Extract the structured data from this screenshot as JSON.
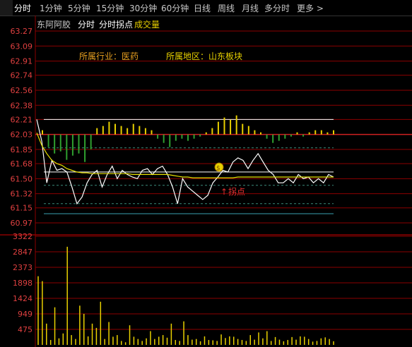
{
  "tabs": [
    {
      "label": "分时",
      "active": true
    },
    {
      "label": "1分钟"
    },
    {
      "label": "5分钟"
    },
    {
      "label": "15分钟"
    },
    {
      "label": "30分钟"
    },
    {
      "label": "60分钟"
    },
    {
      "label": "日线"
    },
    {
      "label": "周线"
    },
    {
      "label": "月线"
    },
    {
      "label": "多分时"
    },
    {
      "label": "更多 >"
    }
  ],
  "subbar": {
    "stock_name": "东阿阿胶",
    "mode": "分时",
    "indicator": "分时拐点",
    "volume_label": "成交量"
  },
  "annotations": {
    "industry": "所属行业：医药",
    "region": "所属地区：山东板块",
    "turning_point": "拐点",
    "money_icon": "money-bag-icon"
  },
  "colors": {
    "price_line": "#ffffff",
    "avg_line": "#e8e000",
    "up": "#e03030",
    "down": "#2fa02f",
    "grid": "#8b0000",
    "axis_label": "#e04040"
  },
  "chart_data": [
    {
      "type": "line",
      "title": "分时",
      "y_ticks": [
        "63.27",
        "63.09",
        "62.91",
        "62.74",
        "62.56",
        "62.38",
        "62.21",
        "62.03",
        "61.85",
        "61.68",
        "61.50",
        "61.32",
        "61.15",
        "60.97"
      ],
      "ylim": [
        60.97,
        63.27
      ],
      "prev_close": 62.03,
      "series": [
        {
          "name": "price",
          "values": [
            62.21,
            61.95,
            61.45,
            61.72,
            61.6,
            61.62,
            61.58,
            61.4,
            61.2,
            61.28,
            61.45,
            61.55,
            61.6,
            61.4,
            61.55,
            61.65,
            61.5,
            61.6,
            61.55,
            61.52,
            61.5,
            61.6,
            61.62,
            61.55,
            61.62,
            61.65,
            61.55,
            61.4,
            61.2,
            61.5,
            61.4,
            61.35,
            61.3,
            61.25,
            61.3,
            61.45,
            61.52,
            61.6,
            61.58,
            61.7,
            61.75,
            61.72,
            61.62,
            61.72,
            61.8,
            61.7,
            61.6,
            61.55,
            61.45,
            61.45,
            61.5,
            61.45,
            61.55,
            61.5,
            61.52,
            61.45,
            61.5,
            61.45,
            61.55,
            61.52
          ]
        },
        {
          "name": "avg",
          "values": [
            62.05,
            61.9,
            61.8,
            61.72,
            61.68,
            61.66,
            61.62,
            61.6,
            61.58,
            61.57,
            61.57,
            61.56,
            61.56,
            61.56,
            61.56,
            61.56,
            61.56,
            61.56,
            61.56,
            61.55,
            61.55,
            61.55,
            61.55,
            61.55,
            61.55,
            61.55,
            61.55,
            61.54,
            61.53,
            61.52,
            61.52,
            61.51,
            61.51,
            61.51,
            61.51,
            61.51,
            61.51,
            61.51,
            61.51,
            61.51,
            61.52,
            61.52,
            61.52,
            61.52,
            61.52,
            61.52,
            61.52,
            61.52,
            61.52,
            61.52,
            61.52,
            61.52,
            61.52,
            61.52,
            61.52,
            61.52,
            61.52,
            61.52,
            61.52,
            61.52
          ]
        }
      ],
      "bars": [
        0.2,
        -0.6,
        -0.9,
        -0.8,
        -1.2,
        -1.0,
        -0.9,
        -1.3,
        -0.7,
        0.3,
        0.4,
        0.6,
        0.5,
        0.4,
        0.3,
        0.5,
        0.4,
        0.3,
        0.2,
        -0.2,
        -0.4,
        -0.6,
        -0.3,
        -0.2,
        -0.3,
        -0.2,
        -0.1,
        0.1,
        0.3,
        0.6,
        0.8,
        0.7,
        0.9,
        0.5,
        0.4,
        0.2,
        0.1,
        -0.2,
        -0.4,
        -0.3,
        -0.2,
        -0.1,
        0.1,
        -0.1,
        0.1,
        0.2,
        0.2,
        0.1,
        0.2
      ]
    },
    {
      "type": "bar",
      "title": "成交量",
      "y_ticks": [
        "3322",
        "2847",
        "2373",
        "1898",
        "1424",
        "949",
        "475"
      ],
      "ylim": [
        0,
        3322
      ],
      "values": [
        2100,
        1950,
        650,
        150,
        1150,
        200,
        350,
        3000,
        300,
        180,
        1200,
        950,
        260,
        650,
        520,
        1320,
        180,
        700,
        250,
        300,
        120,
        80,
        600,
        250,
        180,
        120,
        200,
        420,
        180,
        250,
        300,
        220,
        650,
        150,
        120,
        720,
        300,
        160,
        180,
        110,
        260,
        150,
        140,
        120,
        320,
        210,
        260,
        250,
        180,
        150,
        120,
        300,
        160,
        380,
        200,
        420,
        120,
        240,
        160,
        110,
        150,
        240,
        160,
        260,
        250,
        180,
        100,
        120,
        200,
        230,
        180,
        110
      ]
    }
  ]
}
